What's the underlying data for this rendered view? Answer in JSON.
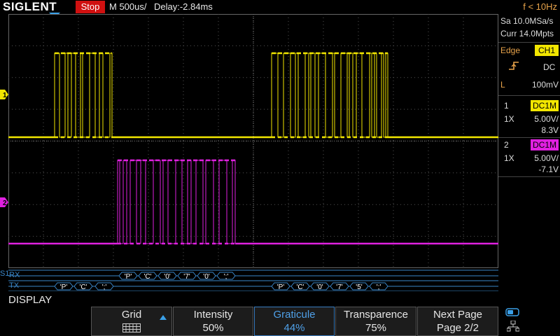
{
  "brand": "SIGLENT",
  "status": "Stop",
  "timebase": "M 500us/",
  "delay": "Delay:-2.84ms",
  "trigger_freq": "f < 10Hz",
  "sample_rate": "Sa 10.0MSa/s",
  "memory": "Curr 14.0Mpts",
  "trigger": {
    "type": "Edge",
    "source": "CH1",
    "coupling": "DC",
    "level_prefix": "L",
    "level": "100mV"
  },
  "channels": [
    {
      "num": "1",
      "coupling": "DC1M",
      "probe": "1X",
      "scale": "5.00V/",
      "offset": "8.3V",
      "color": "#f2e600"
    },
    {
      "num": "2",
      "coupling": "DC1M",
      "probe": "1X",
      "scale": "5.00V/",
      "offset": "-7.1V",
      "color": "#e020e0"
    }
  ],
  "decode": {
    "bus_label": "S1",
    "rx_label": "RX",
    "tx_label": "TX",
    "rx_bytes": [
      "'P'",
      "'C'",
      "'0'",
      "'7'",
      "'0'",
      "';'"
    ],
    "tx_bytes_a": [
      "'P'",
      "'C'",
      "';'"
    ],
    "tx_bytes_b": [
      "'P'",
      "'C'",
      "'0'",
      "'7'",
      "'5'",
      "';'"
    ],
    "color": "#3a86c8"
  },
  "menu_title": "DISPLAY",
  "softkeys": [
    {
      "label": "Grid",
      "value": "",
      "icon": "grid-icon"
    },
    {
      "label": "Intensity",
      "value": "50%"
    },
    {
      "label": "Graticule",
      "value": "44%"
    },
    {
      "label": "Transparence",
      "value": "75%"
    },
    {
      "label": "Next Page",
      "value": "Page 2/2"
    }
  ]
}
